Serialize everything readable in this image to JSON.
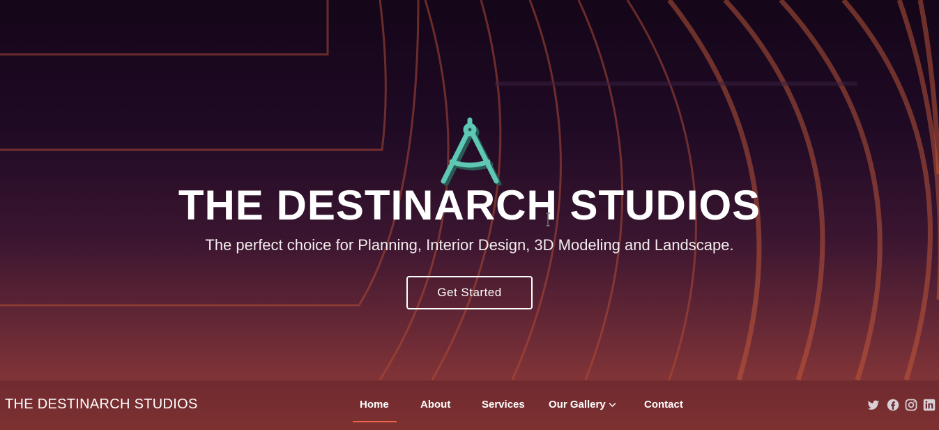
{
  "hero": {
    "title": "THE DESTINARCH STUDIOS",
    "subtitle": "The perfect choice for Planning, Interior Design, 3D Modeling and Landscape.",
    "cta_label": "Get Started"
  },
  "navbar": {
    "brand": "THE DESTINARCH STUDIOS",
    "items": [
      {
        "label": "Home",
        "active": true
      },
      {
        "label": "About"
      },
      {
        "label": "Services"
      },
      {
        "label": "Our Gallery",
        "has_dropdown": true
      },
      {
        "label": "Contact"
      }
    ],
    "socials": [
      "twitter-icon",
      "facebook-icon",
      "instagram-icon",
      "linkedin-icon"
    ]
  },
  "colors": {
    "accent": "#e8644a",
    "logo": "#5ec8b4",
    "text": "#ffffff"
  }
}
